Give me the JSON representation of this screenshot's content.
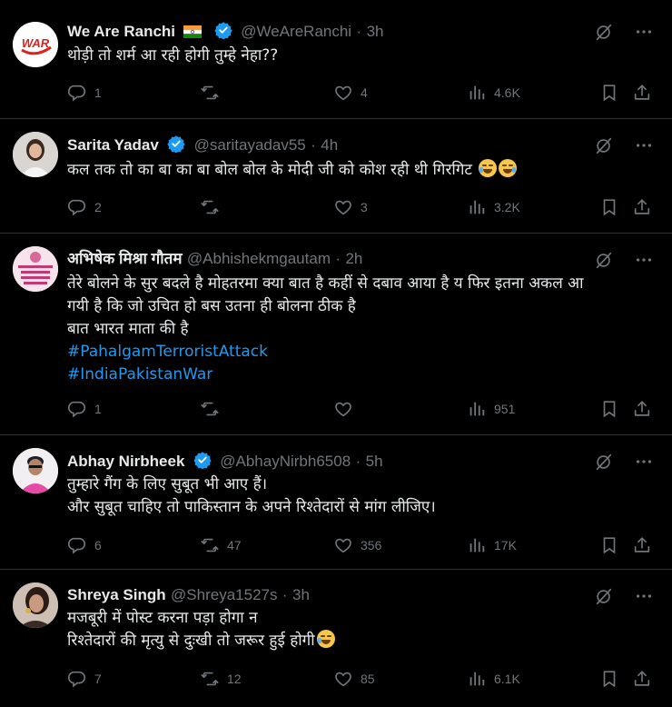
{
  "tweets": [
    {
      "name": "We Are Ranchi",
      "flag": "india-flag",
      "handle": "@WeAreRanchi",
      "time": "3h",
      "text_lines": [
        "थोड़ी तो शर्म आ रही होगी तुम्हे नेहा??"
      ],
      "avatar_text": "WAR",
      "replies": "1",
      "reposts": "",
      "likes": "4",
      "views": "4.6K"
    },
    {
      "name": "Sarita Yadav",
      "handle": "@saritayadav55",
      "time": "4h",
      "text_lines": [
        "कल तक तो का बा का बा बोल बोल के मोदी जी को कोश रही थी गिरगिट"
      ],
      "replies": "2",
      "reposts": "",
      "likes": "3",
      "views": "3.2K"
    },
    {
      "name": "अभिषेक मिश्रा गौतम",
      "handle": "@Abhishekmgautam",
      "time": "2h",
      "text_lines": [
        "तेरे बोलने के सुर बदले है मोहतरमा क्या बात है कहीं से दबाव आया है य फिर इतना अकल आ",
        "गयी है कि जो उचित हो बस उतना ही बोलना ठीक है",
        "बात भारत माता की है"
      ],
      "hashtags": [
        "#PahalgamTerroristAttack",
        "#IndiaPakistanWar"
      ],
      "replies": "1",
      "reposts": "",
      "likes": "",
      "views": "951"
    },
    {
      "name": "Abhay Nirbheek",
      "handle": "@AbhayNirbh6508",
      "time": "5h",
      "text_lines": [
        "तुम्हारे गैंग के लिए सुबूत भी आए हैं।",
        "और सुबूत चाहिए तो पाकिस्तान के अपने रिश्तेदारों से मांग लीजिए।"
      ],
      "replies": "6",
      "reposts": "47",
      "likes": "356",
      "views": "17K"
    },
    {
      "name": "Shreya Singh",
      "handle": "@Shreya1527s",
      "time": "3h",
      "text_lines": [
        "मजबूरी में पोस्ट करना पड़ा होगा न",
        "रिश्तेदारों की मृत्यु से दुःखी तो जरूर हुई होगी"
      ],
      "replies": "7",
      "reposts": "12",
      "likes": "85",
      "views": "6.1K"
    }
  ],
  "separator": "·",
  "colors": {
    "accent": "#1d9bf0",
    "muted": "#71767b",
    "border": "#2f3336",
    "verified": "#1d9bf0"
  }
}
